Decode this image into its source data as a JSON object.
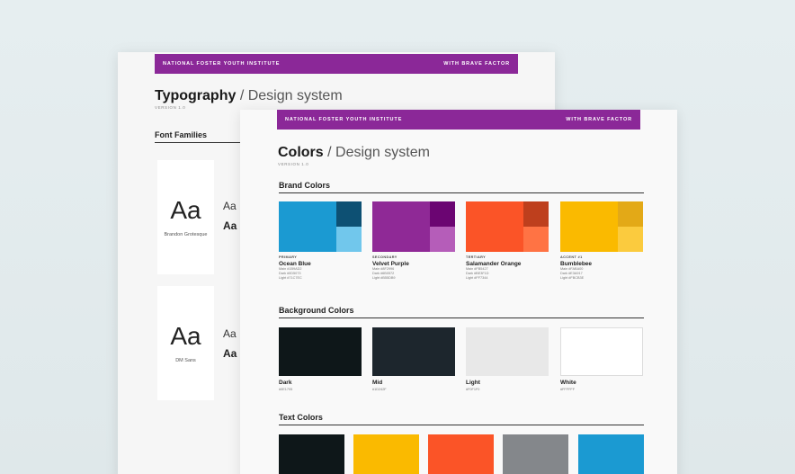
{
  "typography_page": {
    "banner": {
      "left": "NATIONAL FOSTER YOUTH INSTITUTE",
      "right": "WITH BRAVE FACTOR"
    },
    "title_bold": "Typography",
    "title_rest": "/ Design system",
    "version": "VERSION 1.0",
    "section": "Font Families",
    "fonts": [
      {
        "sample": "Aa",
        "name": "Brandon Grotesque",
        "regular": "Aa",
        "bold": "Aa"
      },
      {
        "sample": "Aa",
        "name": "DM Sans",
        "regular": "Aa",
        "bold": "Aa"
      }
    ]
  },
  "colors_page": {
    "banner": {
      "left": "NATIONAL FOSTER YOUTH INSTITUTE",
      "right": "WITH BRAVE FACTOR"
    },
    "title_bold": "Colors",
    "title_rest": "/ Design system",
    "version": "VERSION 1.0",
    "brand_section": "Brand Colors",
    "brand_colors": [
      {
        "role": "PRIMARY",
        "name": "Ocean Blue",
        "main": "Main #1B9AD2",
        "dark": "Dark #0D5073",
        "light": "Light #71C7EC",
        "c_main": "#1b9ad2",
        "c_dark": "#0d5073",
        "c_light": "#71c7ec"
      },
      {
        "role": "SECONDARY",
        "name": "Velvet Purple",
        "main": "Main #8F2996",
        "dark": "Dark #6B0572",
        "light": "Light #B55DB9",
        "c_main": "#8f2996",
        "c_dark": "#6b0572",
        "c_light": "#b55db9"
      },
      {
        "role": "TERTIARY",
        "name": "Salamander Orange",
        "main": "Main #FB5427",
        "dark": "Dark #BE3F1D",
        "light": "Light #FF7344",
        "c_main": "#fb5427",
        "c_dark": "#be3f1d",
        "c_light": "#ff7344"
      },
      {
        "role": "ACCENT #1",
        "name": "Bumblebee",
        "main": "Main #FABA00",
        "dark": "Dark #E3A917",
        "light": "Light #FBCB3E",
        "c_main": "#faba00",
        "c_dark": "#e3a917",
        "c_light": "#fbcb3e"
      }
    ],
    "background_section": "Background Colors",
    "background_colors": [
      {
        "name": "Dark",
        "hex": "#0E1705",
        "color": "#0e1719"
      },
      {
        "name": "Mid",
        "hex": "#1D242F",
        "color": "#1d262d"
      },
      {
        "name": "Light",
        "hex": "#F0F1F0",
        "color": "#e8e8e8"
      },
      {
        "name": "White",
        "hex": "#FFFFFF",
        "color": "#ffffff"
      }
    ],
    "text_section": "Text Colors",
    "text_colors": [
      "#0e1719",
      "#faba00",
      "#fb5427",
      "#84878b",
      "#1b9ad2"
    ]
  }
}
